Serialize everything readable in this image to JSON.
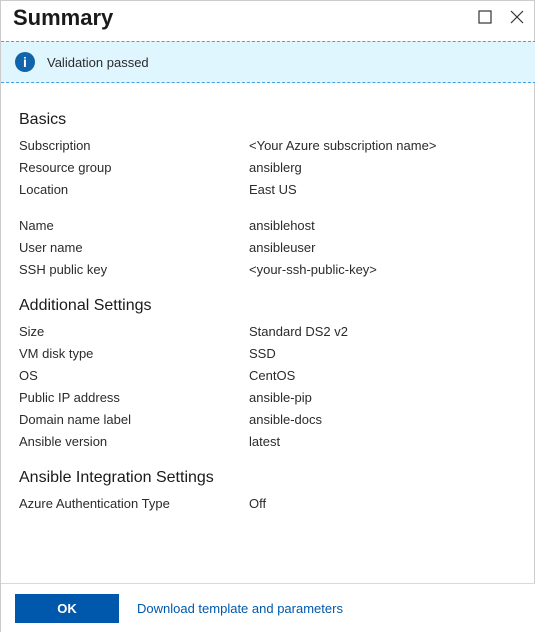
{
  "header": {
    "title": "Summary"
  },
  "validation": {
    "message": "Validation passed",
    "icon_glyph": "i"
  },
  "sections": {
    "basics": {
      "heading": "Basics",
      "group1": [
        {
          "label": "Subscription",
          "value": "<Your Azure subscription name>"
        },
        {
          "label": "Resource group",
          "value": "ansiblerg"
        },
        {
          "label": "Location",
          "value": "East US"
        }
      ],
      "group2": [
        {
          "label": "Name",
          "value": "ansiblehost"
        },
        {
          "label": "User name",
          "value": "ansibleuser"
        },
        {
          "label": "SSH public key",
          "value": "<your-ssh-public-key>"
        }
      ]
    },
    "additional": {
      "heading": "Additional Settings",
      "rows": [
        {
          "label": "Size",
          "value": "Standard DS2 v2"
        },
        {
          "label": "VM disk type",
          "value": "SSD"
        },
        {
          "label": "OS",
          "value": "CentOS"
        },
        {
          "label": "Public IP address",
          "value": "ansible-pip"
        },
        {
          "label": "Domain name label",
          "value": "ansible-docs"
        },
        {
          "label": "Ansible version",
          "value": "latest"
        }
      ]
    },
    "integration": {
      "heading": "Ansible Integration Settings",
      "rows": [
        {
          "label": "Azure Authentication Type",
          "value": "Off"
        }
      ]
    }
  },
  "footer": {
    "ok_label": "OK",
    "download_label": "Download template and parameters"
  }
}
